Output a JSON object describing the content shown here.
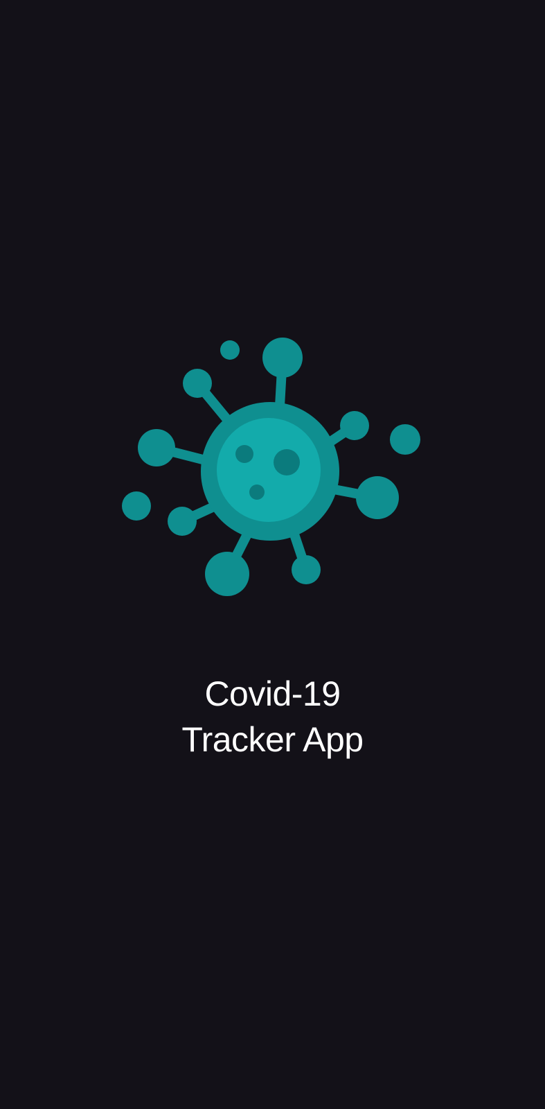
{
  "app": {
    "title_line1": "Covid-19",
    "title_line2": "Tracker App"
  },
  "logo": {
    "icon": "virus-icon"
  },
  "colors": {
    "background": "#131118",
    "virus_primary": "#0f8f90",
    "virus_core": "#13abab",
    "virus_spot": "#0b7b7d",
    "text": "#ffffff"
  }
}
